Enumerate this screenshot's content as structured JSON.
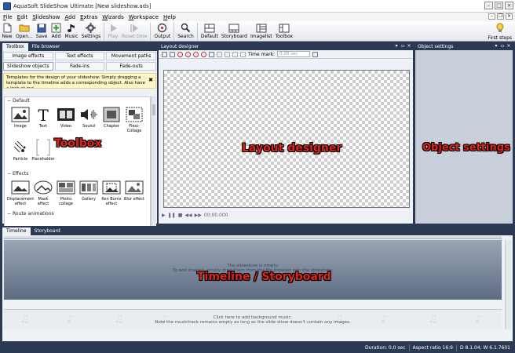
{
  "window": {
    "title": "AquaSoft SlideShow Ultimate [New slideshow.ads]"
  },
  "menu": [
    "File",
    "Edit",
    "Slideshow",
    "Add",
    "Extras",
    "Wizards",
    "Workspace",
    "Help"
  ],
  "toolbar": {
    "new": "New",
    "open": "Open...",
    "save": "Save",
    "add": "Add",
    "music": "Music",
    "settings": "Settings",
    "play": "Play",
    "reset_time": "Reset time",
    "output": "Output",
    "search": "Search",
    "default": "Default",
    "storyboard": "Storyboard",
    "imagelist": "Imagelist",
    "toolbox": "Toolbox",
    "first_steps": "First steps"
  },
  "toolbox": {
    "tabs": [
      "Toolbox",
      "File browser"
    ],
    "subtabs_row1": [
      "Image effects",
      "Text effects",
      "Movement paths"
    ],
    "subtabs_row2": [
      "Slideshow objects",
      "Fade-ins",
      "Fade-outs"
    ],
    "hint": "Templates for the design of your slideshow: Simply dragging a template to the timeline adds a corresponding object. Also have a look at our ...",
    "groups": {
      "default": "Default",
      "effects": "Effects",
      "route": "Route animations"
    },
    "default_items": [
      "Image",
      "Text",
      "Video",
      "Sound",
      "Chapter",
      "Flexi-Collage",
      "Particle",
      "Placeholder"
    ],
    "effect_items": [
      "Displacement effect",
      "Mask effect",
      "Photo collage",
      "Gallery",
      "Ken Burns effect",
      "Blur effect"
    ],
    "filter_placeholder": "Filter",
    "overlay": "Toolbox"
  },
  "layout": {
    "header": "Layout designer",
    "time_mark_label": "Time mark:",
    "time_mark_value": "0,00 sec",
    "play_time": "00:00.000",
    "overlay": "Layout designer"
  },
  "objset": {
    "header": "Object settings",
    "overlay": "Object settings"
  },
  "timeline": {
    "tabs": [
      "Timeline",
      "Storyboard"
    ],
    "empty_1": "The slideshow is empty.",
    "empty_2": "To add images, simply drag them from the file browser into the slideshow.",
    "music_1": "Click here to add background music.",
    "music_2": "Note the musictrack remains empty as long as the slide show doesn't contain any images.",
    "overlay": "Timeline / Storyboard"
  },
  "status": {
    "duration": "Duration: 0,0 sec",
    "aspect": "Aspect ratio 16:9",
    "version": "D 8.1.04, W 6.1.7601"
  }
}
